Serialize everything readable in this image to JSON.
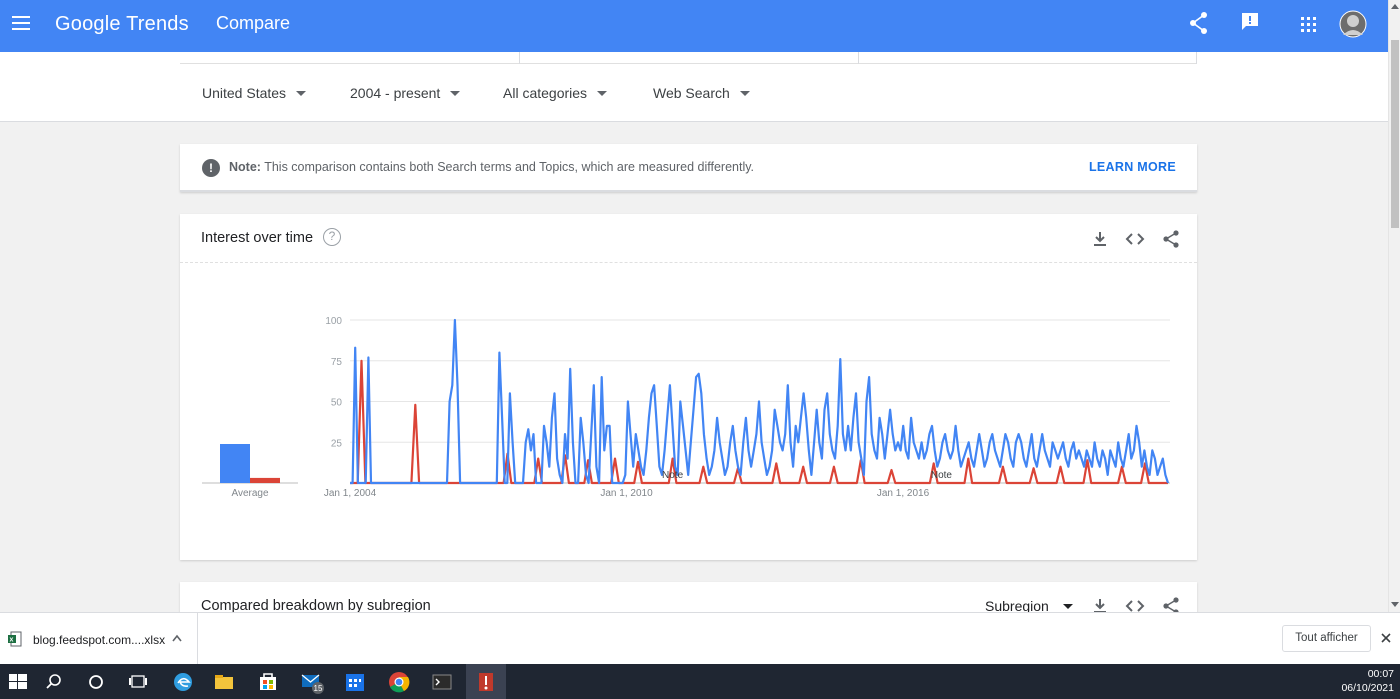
{
  "header": {
    "logo": "Google Trends",
    "title": "Compare",
    "icons": [
      "menu-icon",
      "share-icon",
      "feedback-icon",
      "apps-icon",
      "avatar"
    ]
  },
  "filters": {
    "region": "United States",
    "period": "2004 - present",
    "category": "All categories",
    "search_type": "Web Search"
  },
  "note": {
    "label": "Note:",
    "text": "This comparison contains both Search terms and Topics, which are measured differently.",
    "link": "LEARN MORE"
  },
  "interest_card": {
    "title": "Interest over time",
    "help": "?",
    "average_label": "Average",
    "note_markers": [
      "Note",
      "Note"
    ]
  },
  "subregion_card": {
    "title": "Compared breakdown by subregion",
    "dropdown": "Subregion"
  },
  "downloads": {
    "file": "blog.feedspot.com....xlsx",
    "show_all": "Tout afficher"
  },
  "taskbar": {
    "time": "00:07",
    "date": "06/10/2021",
    "mail_badge": "15"
  },
  "colors": {
    "brand": "#4285f4",
    "series_blue": "#4285f4",
    "series_red": "#db4437",
    "link": "#1a73e8"
  },
  "chart_data": {
    "type": "line",
    "title": "Interest over time",
    "xlabel": "",
    "ylabel": "",
    "x_start": "2004-01",
    "x_end": "2021-10",
    "x_step": "month",
    "x_ticks": [
      "Jan 1, 2004",
      "Jan 1, 2010",
      "Jan 1, 2016"
    ],
    "y_ticks": [
      100,
      75,
      50,
      25
    ],
    "ylim": [
      0,
      100
    ],
    "grid": true,
    "averages": [
      {
        "series": "blue",
        "value": 23
      },
      {
        "series": "red",
        "value": 3
      }
    ],
    "series": [
      {
        "color": "#4285f4",
        "values": [
          0,
          0,
          83,
          0,
          0,
          0,
          0,
          77,
          0,
          0,
          0,
          0,
          0,
          0,
          0,
          0,
          0,
          0,
          0,
          0,
          0,
          0,
          0,
          0,
          0,
          0,
          0,
          0,
          0,
          0,
          0,
          0,
          0,
          0,
          0,
          0,
          0,
          0,
          50,
          60,
          100,
          60,
          0,
          0,
          0,
          0,
          0,
          0,
          0,
          0,
          0,
          0,
          0,
          0,
          0,
          0,
          0,
          80,
          40,
          0,
          0,
          55,
          25,
          0,
          0,
          0,
          0,
          25,
          33,
          20,
          30,
          0,
          0,
          0,
          35,
          25,
          10,
          40,
          55,
          15,
          5,
          0,
          30,
          15,
          70,
          25,
          0,
          0,
          40,
          25,
          5,
          0,
          30,
          60,
          10,
          0,
          65,
          20,
          35,
          35,
          0,
          0,
          0,
          0,
          0,
          5,
          50,
          30,
          10,
          30,
          20,
          10,
          5,
          20,
          40,
          55,
          60,
          35,
          10,
          5,
          20,
          40,
          60,
          35,
          10,
          5,
          50,
          35,
          20,
          5,
          25,
          45,
          65,
          67,
          55,
          30,
          15,
          5,
          10,
          20,
          40,
          25,
          15,
          5,
          10,
          25,
          35,
          20,
          10,
          5,
          25,
          40,
          20,
          10,
          20,
          30,
          50,
          25,
          15,
          5,
          10,
          20,
          45,
          35,
          25,
          20,
          30,
          60,
          25,
          10,
          35,
          25,
          40,
          55,
          40,
          20,
          5,
          25,
          45,
          25,
          15,
          45,
          55,
          30,
          20,
          15,
          35,
          76,
          30,
          20,
          35,
          20,
          40,
          55,
          25,
          15,
          5,
          50,
          65,
          30,
          20,
          15,
          40,
          30,
          15,
          30,
          45,
          30,
          20,
          25,
          20,
          35,
          20,
          15,
          40,
          25,
          20,
          15,
          25,
          15,
          20,
          30,
          35,
          20,
          10,
          15,
          25,
          30,
          20,
          15,
          20,
          35,
          20,
          10,
          15,
          20,
          25,
          15,
          10,
          20,
          30,
          20,
          10,
          15,
          25,
          30,
          20,
          15,
          10,
          20,
          30,
          25,
          15,
          10,
          25,
          30,
          25,
          15,
          10,
          20,
          30,
          15,
          10,
          20,
          30,
          20,
          15,
          10,
          25,
          20,
          15,
          20,
          25,
          15,
          10,
          20,
          25,
          15,
          20,
          15,
          10,
          20,
          15,
          10,
          25,
          15,
          10,
          20,
          15,
          5,
          20,
          15,
          10,
          25,
          15,
          10,
          20,
          30,
          15,
          20,
          35,
          25,
          10,
          20,
          10,
          5,
          20,
          15,
          5,
          10,
          15,
          5,
          0
        ]
      },
      {
        "color": "#db4437",
        "values": [
          0,
          0,
          0,
          0,
          0,
          0,
          0,
          0,
          0,
          0,
          0,
          0,
          0,
          0,
          0,
          0,
          0,
          0,
          0,
          0,
          0,
          0,
          0,
          0,
          0,
          0,
          0,
          0,
          0,
          0,
          0,
          0,
          0,
          0,
          0,
          0,
          0,
          0,
          0,
          0,
          0,
          0,
          0,
          0,
          0,
          0,
          0,
          0,
          0,
          0,
          0,
          0,
          0,
          0,
          0,
          0,
          0,
          0,
          0,
          0,
          0,
          0,
          0,
          0,
          0,
          0,
          0,
          0,
          0,
          0,
          0,
          0,
          0,
          0,
          0,
          0,
          0,
          0,
          0,
          0,
          0,
          0,
          0,
          0,
          0,
          0,
          0,
          0,
          0,
          0,
          0,
          0,
          0,
          0,
          0,
          0,
          0,
          0,
          0,
          0,
          0,
          0,
          0,
          0,
          0,
          0,
          0,
          0,
          0,
          0,
          0,
          0,
          0,
          0,
          0,
          0,
          0,
          0,
          0,
          0,
          0,
          0,
          0,
          0,
          0,
          0,
          0,
          0,
          0,
          0,
          0,
          0,
          0,
          0,
          0,
          0,
          0,
          0,
          0,
          0,
          0,
          0,
          0,
          0,
          0,
          0,
          0,
          0,
          0,
          0,
          0,
          0,
          0,
          0,
          0,
          0,
          0,
          0,
          0,
          0,
          0,
          0,
          0,
          0,
          0,
          0,
          0,
          0,
          0,
          0,
          0,
          0,
          0,
          0,
          0,
          0,
          0,
          0,
          0,
          0,
          0,
          0,
          0,
          0,
          0,
          0,
          0,
          0,
          0,
          0,
          0,
          0,
          0,
          0,
          0,
          0,
          0,
          0,
          0,
          0,
          0,
          0,
          0,
          0,
          0,
          0,
          0,
          0,
          0,
          0,
          0,
          0,
          0,
          0,
          0,
          0,
          0,
          0,
          0,
          0,
          0,
          0,
          0,
          0,
          0,
          0,
          0,
          0,
          0,
          0,
          0,
          0,
          0,
          0,
          0,
          0,
          0,
          0,
          0,
          0,
          0,
          0,
          0,
          0,
          0,
          0,
          0,
          0,
          0,
          0,
          0,
          0,
          0,
          0,
          0,
          0,
          0,
          0,
          0,
          0,
          0,
          0,
          0,
          0,
          0,
          0,
          0,
          0,
          0,
          0,
          0,
          0,
          0,
          0,
          0,
          0,
          0,
          0,
          0,
          0,
          0,
          0,
          0,
          0,
          0,
          0,
          0,
          0,
          0,
          0,
          0,
          0,
          0,
          0,
          0,
          0,
          0,
          0,
          0,
          0,
          0,
          0,
          0,
          0,
          0,
          0,
          0,
          0,
          0,
          0,
          0,
          0,
          0,
          0,
          0,
          0,
          0,
          0,
          0,
          0,
          0,
          0,
          0,
          0,
          0,
          0,
          0,
          0,
          0,
          0,
          0,
          0,
          0,
          0,
          0,
          0,
          0,
          0,
          0,
          0,
          0,
          0,
          0,
          0,
          0,
          0,
          0,
          0,
          0,
          0,
          0,
          0,
          0,
          0,
          0,
          0,
          0,
          0
        ],
        "peaks": [
          {
            "x": "2004-04",
            "y": 75
          },
          {
            "x": "2005-06",
            "y": 48
          },
          {
            "x": "2007-06",
            "y": 18
          },
          {
            "x": "2008-02",
            "y": 15
          },
          {
            "x": "2008-09",
            "y": 17
          },
          {
            "x": "2009-03",
            "y": 14
          },
          {
            "x": "2009-10",
            "y": 15
          },
          {
            "x": "2010-04",
            "y": 13
          },
          {
            "x": "2011-01",
            "y": 15
          },
          {
            "x": "2011-09",
            "y": 10
          },
          {
            "x": "2012-06",
            "y": 9
          },
          {
            "x": "2013-04",
            "y": 12
          },
          {
            "x": "2013-11",
            "y": 10
          },
          {
            "x": "2014-07",
            "y": 10
          },
          {
            "x": "2015-02",
            "y": 14
          },
          {
            "x": "2015-10",
            "y": 8
          },
          {
            "x": "2016-09",
            "y": 12
          },
          {
            "x": "2017-06",
            "y": 15
          },
          {
            "x": "2018-03",
            "y": 10
          },
          {
            "x": "2018-11",
            "y": 9
          },
          {
            "x": "2019-06",
            "y": 10
          },
          {
            "x": "2020-01",
            "y": 14
          },
          {
            "x": "2020-10",
            "y": 10
          },
          {
            "x": "2021-04",
            "y": 12
          }
        ]
      }
    ]
  }
}
